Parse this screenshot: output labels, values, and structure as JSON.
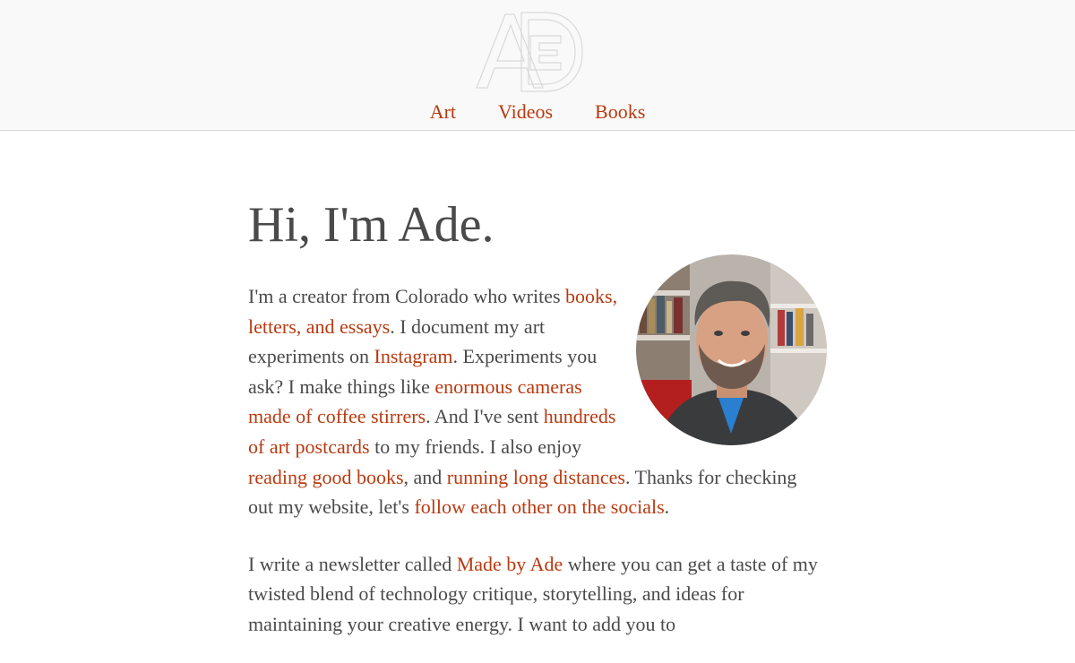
{
  "header": {
    "logo_icon": "ade-monogram-logo",
    "nav": [
      {
        "label": "Art"
      },
      {
        "label": "Videos"
      },
      {
        "label": "Books"
      }
    ]
  },
  "main": {
    "title": "Hi, I'm Ade.",
    "portrait_icon": "portrait-photo",
    "intro": {
      "t1": "I'm a creator from Colorado who writes ",
      "l1": "books, letters, and essays",
      "t2": ". I document my art experiments on ",
      "l2": "Instagram",
      "t3": ". Experiments you ask? I make things like ",
      "l3": "enormous cameras made of coffee stirrers",
      "t4": ". And I've sent ",
      "l4": "hundreds of art postcards",
      "t5": " to my friends. I also enjoy ",
      "l5": "reading good books",
      "t6": ", and ",
      "l6": "running long distances",
      "t7": ". Thanks for checking out my website, let's ",
      "l7": "follow each other on the socials",
      "t8": "."
    },
    "newsletter": {
      "t1": "I write a newsletter called ",
      "l1": "Made by Ade",
      "t2": " where you can get a taste of my twisted blend of technology critique, storytelling, and ideas for maintaining your creative energy. I want to add you to"
    }
  },
  "colors": {
    "link": "#b83a10",
    "text": "#4a4a4a",
    "header_bg": "#f9f9f9"
  }
}
